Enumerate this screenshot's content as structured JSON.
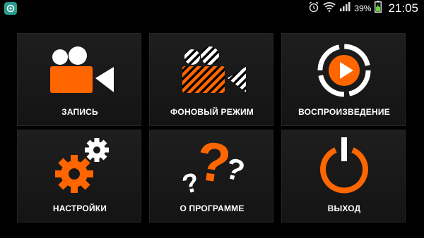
{
  "status_bar": {
    "app_icon": "app-notification-icon",
    "icons": [
      "alarm-icon",
      "wifi-icon",
      "signal-icon",
      "battery-icon"
    ],
    "battery_percent": "39%",
    "time": "21:05"
  },
  "menu": {
    "accent_color": "#ff6600",
    "tiles": [
      {
        "label": "ЗАПИСЬ",
        "icon": "video-camera-icon"
      },
      {
        "label": "ФОНОВЫЙ РЕЖИМ",
        "icon": "striped-video-camera-icon"
      },
      {
        "label": "ВОСПРОИЗВЕДЕНИЕ",
        "icon": "play-ring-icon"
      },
      {
        "label": "НАСТРОЙКИ",
        "icon": "gears-icon"
      },
      {
        "label": "О ПРОГРАММЕ",
        "icon": "question-marks-icon"
      },
      {
        "label": "ВЫХОД",
        "icon": "power-icon"
      }
    ]
  }
}
